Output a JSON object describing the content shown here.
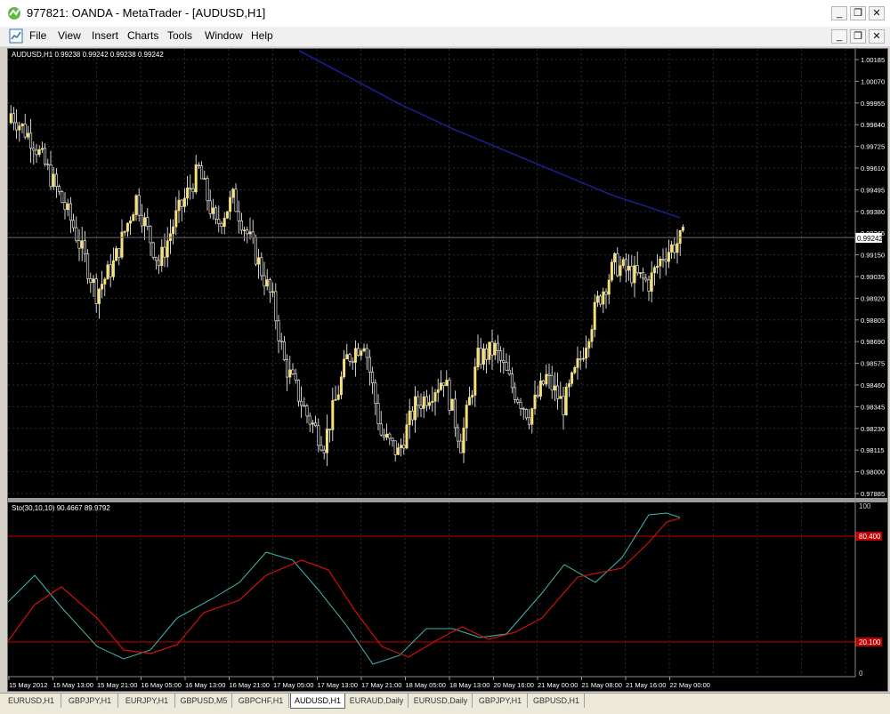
{
  "window": {
    "title": "977821: OANDA - MetaTrader - [AUDUSD,H1]",
    "min_glyph": "_",
    "restore_glyph": "❐",
    "close_glyph": "✕"
  },
  "menu": {
    "items": [
      "File",
      "View",
      "Insert",
      "Charts",
      "Tools",
      "Window",
      "Help"
    ]
  },
  "main_chart": {
    "header": "AUDUSD,H1  0.99238 0.99242 0.99238 0.99242",
    "price_labels": [
      "1.00185",
      "1.00070",
      "0.99955",
      "0.99840",
      "0.99725",
      "0.99610",
      "0.99495",
      "0.99380",
      "0.99265",
      "0.99150",
      "0.99035",
      "0.98920",
      "0.98805",
      "0.98690",
      "0.98575",
      "0.98460",
      "0.98345",
      "0.98230",
      "0.98115",
      "0.98000",
      "0.97885"
    ],
    "current_price": "0.99242",
    "colors": {
      "bull": "#f5e07a",
      "bear": "#ffffff",
      "ma": "#1c1c8c",
      "grid": "#3a3a3a"
    }
  },
  "stoch": {
    "header": "Sto(30,10,10) 90.4667 89.9792",
    "scale_top": "100",
    "scale_bottom": "0",
    "level_high": "80.400",
    "level_low": "20.100",
    "colors": {
      "main": "#3fb9b0",
      "signal": "#d01010",
      "level": "#c00000"
    }
  },
  "time_labels": [
    "15 May 2012",
    "15 May 13:00",
    "15 May 21:00",
    "16 May 05:00",
    "16 May 13:00",
    "16 May 21:00",
    "17 May 05:00",
    "17 May 13:00",
    "17 May 21:00",
    "18 May 05:00",
    "18 May 13:00",
    "20 May 16:00",
    "21 May 00:00",
    "21 May 08:00",
    "21 May 16:00",
    "22 May 00:00"
  ],
  "tabs": [
    {
      "label": "EURUSD,H1",
      "active": false
    },
    {
      "label": "GBPJPY,H1",
      "active": false
    },
    {
      "label": "EURJPY,H1",
      "active": false
    },
    {
      "label": "GBPUSD,M5",
      "active": false
    },
    {
      "label": "GBPCHF,H1",
      "active": false
    },
    {
      "label": "AUDUSD,H1",
      "active": true
    },
    {
      "label": "EURAUD,Daily",
      "active": false
    },
    {
      "label": "EURUSD,Daily",
      "active": false
    },
    {
      "label": "GBPJPY,H1",
      "active": false
    },
    {
      "label": "GBPUSD,H1",
      "active": false
    }
  ]
}
